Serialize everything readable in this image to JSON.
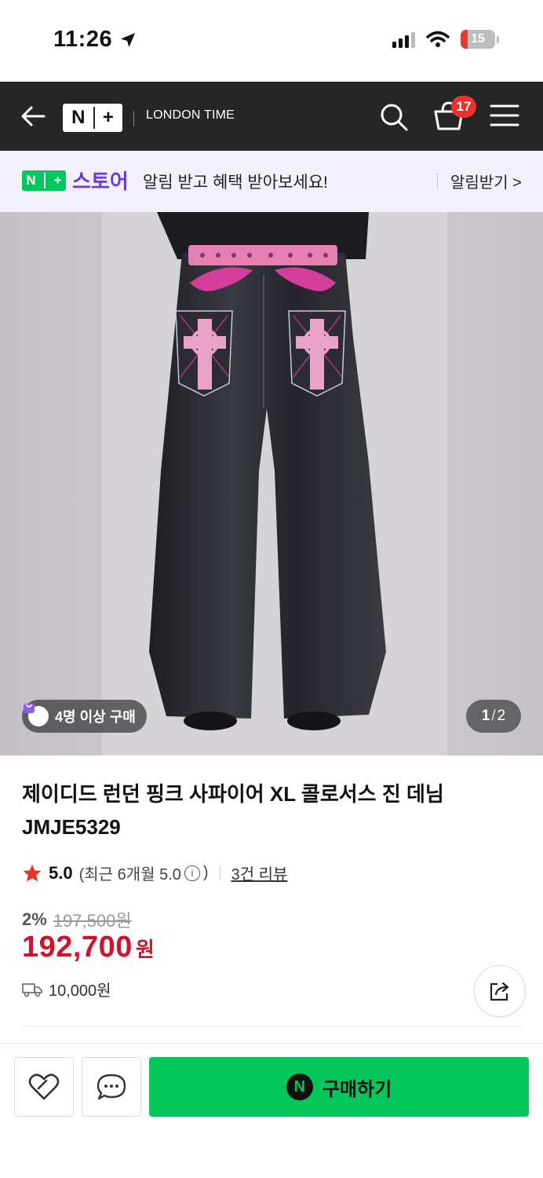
{
  "status_bar": {
    "time": "11:26",
    "battery": "15"
  },
  "header": {
    "shop_name": "LONDON TIME",
    "cart_count": "17",
    "logo": "N+"
  },
  "notice": {
    "store_logo": "N+",
    "store_word": "스토어",
    "message": "알림 받고 혜택 받아보세요!",
    "action": "알림받기 >"
  },
  "gallery": {
    "buyers_badge": "4명 이상 구매",
    "current_page": "1",
    "separator": "/",
    "total_pages": "2"
  },
  "product": {
    "title": "제이디드 런던 핑크 사파이어 XL 콜로서스 진 데님 JMJE5329",
    "rating": "5.0",
    "rating_recent_prefix": "(최근 6개월 5.0",
    "rating_recent_suffix": ")",
    "review_link": "3건 리뷰",
    "discount_rate": "2%",
    "original_price": "197,500원",
    "sale_price": "192,700",
    "sale_unit": "원",
    "shipping_fee": "10,000원"
  },
  "bottom_bar": {
    "buy_label": "구매하기",
    "npay_icon": "N"
  },
  "colors": {
    "accent_green": "#03c75a",
    "sale_red": "#d0122c",
    "header_bg": "#262626",
    "store_purple": "#6b3bd8",
    "rating_star": "#e8322b"
  }
}
